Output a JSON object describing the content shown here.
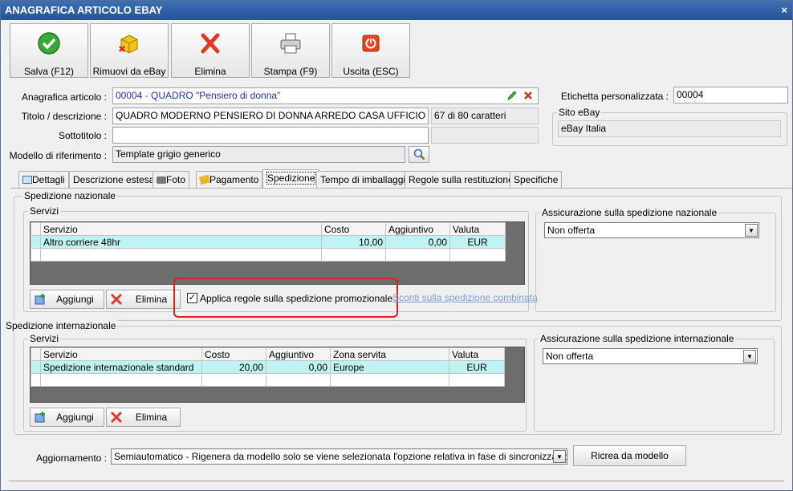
{
  "window": {
    "title": "ANAGRAFICA ARTICOLO EBAY",
    "close": "×"
  },
  "toolbar": [
    {
      "label": "Salva (F12)",
      "icon": "check-icon"
    },
    {
      "label": "Rimuovi da eBay",
      "icon": "box-remove-icon"
    },
    {
      "label": "Elimina",
      "icon": "delete-x-icon"
    },
    {
      "label": "Stampa (F9)",
      "icon": "printer-icon"
    },
    {
      "label": "Uscita (ESC)",
      "icon": "exit-icon"
    }
  ],
  "form": {
    "anagrafica_label": "Anagrafica articolo :",
    "anagrafica_value": "00004 - QUADRO \"Pensiero di donna\"",
    "titolo_label": "Titolo / descrizione :",
    "titolo_value": "QUADRO MODERNO PENSIERO DI DONNA ARREDO CASA UFFICIO QUADRI MODERNI",
    "titolo_counter": "67 di 80 caratteri",
    "sottotitolo_label": "Sottotitolo :",
    "sottotitolo_value": "",
    "modello_label": "Modello di riferimento :",
    "modello_value": "Template grigio generico",
    "etichetta_label": "Etichetta personalizzata :",
    "etichetta_value": "00004",
    "sito_title": "Sito eBay",
    "sito_value": "eBay Italia"
  },
  "tabs": [
    "Dettagli",
    "Descrizione estesa",
    "Foto",
    "Pagamento",
    "Spedizione",
    "Tempo di imballaggio",
    "Regole sulla restituzione",
    "Specifiche"
  ],
  "nazionale": {
    "title": "Spedizione nazionale",
    "servizi_title": "Servizi",
    "columns": [
      "Servizio",
      "Costo",
      "Aggiuntivo",
      "Valuta"
    ],
    "rows": [
      [
        "Altro corriere 48hr",
        "10,00",
        "0,00",
        "EUR"
      ]
    ],
    "add_label": "Aggiungi",
    "delete_label": "Elimina",
    "promo_label": "Applica regole sulla spedizione promozionale",
    "promo_checked": true,
    "sconti_link": "Sconti sulla spedizione combinata",
    "assicurazione_title": "Assicurazione sulla spedizione nazionale",
    "assicurazione_value": "Non offerta"
  },
  "internazionale": {
    "title": "Spedizione internazionale",
    "servizi_title": "Servizi",
    "columns": [
      "Servizio",
      "Costo",
      "Aggiuntivo",
      "Zona servita",
      "Valuta"
    ],
    "rows": [
      [
        "Spedizione internazionale standard",
        "20,00",
        "0,00",
        "Europe",
        "EUR"
      ]
    ],
    "add_label": "Aggiungi",
    "delete_label": "Elimina",
    "assicurazione_title": "Assicurazione sulla spedizione internazionale",
    "assicurazione_value": "Non offerta"
  },
  "footer": {
    "aggiornamento_label": "Aggiornamento :",
    "aggiornamento_value": "Semiautomatico - Rigenera da modello solo se viene selezionata l'opzione relativa in fase di sincronizzazione",
    "ricrea_label": "Ricrea da modello"
  },
  "colors": {
    "title_bar": "#2d5ea6",
    "selected_row": "#bff2f2",
    "annotation": "#e0201c",
    "link": "#7b9fd6"
  }
}
